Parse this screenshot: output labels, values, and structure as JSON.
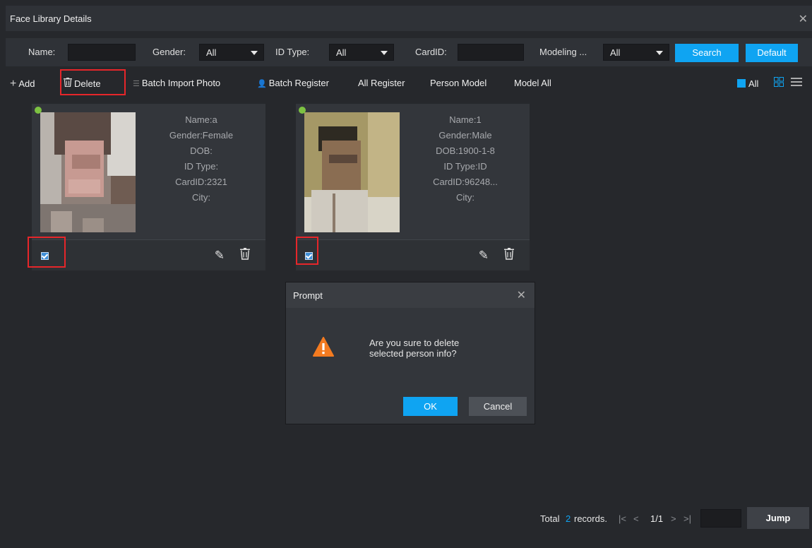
{
  "window": {
    "title": "Face Library Details",
    "close_icon": "close-icon"
  },
  "filters": {
    "name_label": "Name:",
    "name_value": "",
    "gender_label": "Gender:",
    "gender_value": "All",
    "idtype_label": "ID Type:",
    "idtype_value": "All",
    "cardid_label": "CardID:",
    "cardid_value": "",
    "modeling_label": "Modeling ...",
    "modeling_value": "All",
    "search_label": "Search",
    "default_label": "Default"
  },
  "toolbar": {
    "add_label": "Add",
    "delete_label": "Delete",
    "batch_import_label": "Batch Import Photo",
    "batch_register_label": "Batch Register",
    "all_register_label": "All Register",
    "person_model_label": "Person Model",
    "model_all_label": "Model All",
    "all_label": "All"
  },
  "cards": [
    {
      "name": "Name:a",
      "gender": "Gender:Female",
      "dob": "DOB:",
      "idtype": "ID Type:",
      "cardid": "CardID:2321",
      "city": "City:",
      "checked": true
    },
    {
      "name": "Name:1",
      "gender": "Gender:Male",
      "dob": "DOB:1900-1-8",
      "idtype": "ID Type:ID",
      "cardid": "CardID:96248...",
      "city": "City:",
      "checked": true
    }
  ],
  "dialog": {
    "title": "Prompt",
    "message_line1": "Are you sure to delete",
    "message_line2": "selected person info?",
    "ok_label": "OK",
    "cancel_label": "Cancel"
  },
  "pager": {
    "total_prefix": "Total",
    "total_count": "2",
    "total_suffix": "records.",
    "first_icon": "|<",
    "prev_icon": "<",
    "page": "1/1",
    "next_icon": ">",
    "last_icon": ">|",
    "jump_value": "",
    "jump_label": "Jump"
  },
  "colors": {
    "accent": "#0fa4f2",
    "highlight_box": "#e6262a",
    "status_online": "#7dc242",
    "warning": "#f47b20"
  }
}
